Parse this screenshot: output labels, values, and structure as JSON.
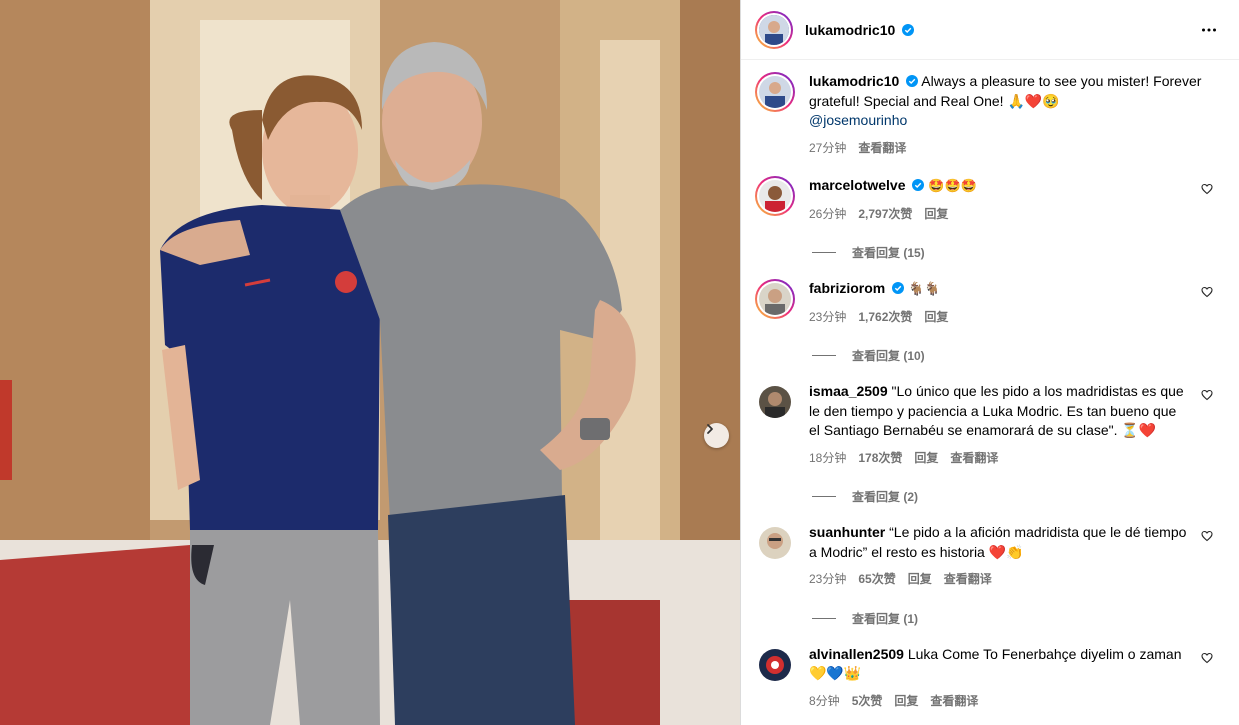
{
  "post": {
    "username": "lukamodric10",
    "caption": {
      "username": "lukamodric10",
      "text": "Always a pleasure to see you mister! Forever grateful! Special and Real One! 🙏❤️🥹",
      "mention": "@josemourinho",
      "time": "27分钟",
      "translate": "查看翻译"
    }
  },
  "comments": [
    {
      "username": "marcelotwelve",
      "verified": true,
      "text": "🤩🤩🤩",
      "time": "26分钟",
      "likes": "2,797次赞",
      "reply": "回复",
      "translate": "",
      "replies": "查看回复 (15)"
    },
    {
      "username": "fabriziorom",
      "verified": true,
      "text": "🐐🐐",
      "time": "23分钟",
      "likes": "1,762次赞",
      "reply": "回复",
      "translate": "",
      "replies": "查看回复 (10)"
    },
    {
      "username": "ismaa_2509",
      "verified": false,
      "text": "\"Lo único que les pido a los madridistas es que le den tiempo y paciencia a Luka Modric. Es tan bueno que el Santiago Bernabéu se enamorará de su clase\". ⏳❤️",
      "time": "18分钟",
      "likes": "178次赞",
      "reply": "回复",
      "translate": "查看翻译",
      "replies": "查看回复 (2)"
    },
    {
      "username": "suanhunter",
      "verified": false,
      "text": "“Le pido a la afición madridista que le dé tiempo a Modric” el resto es historia ❤️👏",
      "time": "23分钟",
      "likes": "65次赞",
      "reply": "回复",
      "translate": "查看翻译",
      "replies": "查看回复 (1)"
    },
    {
      "username": "alvinallen2509",
      "verified": false,
      "text": "Luka Come To Fenerbahçe diyelim o zaman 💛💙👑",
      "time": "8分钟",
      "likes": "5次赞",
      "reply": "回复",
      "translate": "查看翻译",
      "replies": ""
    }
  ],
  "colors": {
    "link": "#00376b",
    "muted": "#737373",
    "verified": "#0095f6"
  },
  "icons": {
    "more": "more-horizontal-icon",
    "like": "heart-outline-icon",
    "next": "chevron-right-icon",
    "verified": "verified-badge-icon"
  }
}
